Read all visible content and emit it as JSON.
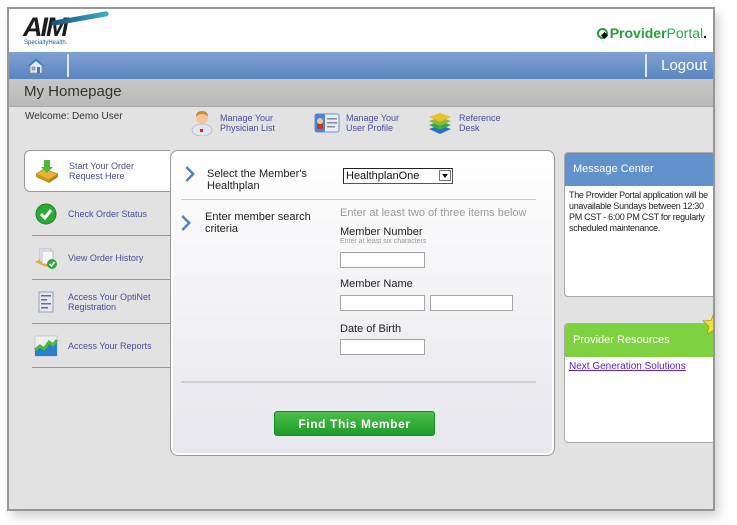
{
  "header": {
    "logo_text": "AIM",
    "logo_subtext": "SpecialtyHealth.",
    "portal_bold": "Provider",
    "portal_light": "Portal",
    "portal_dot": "."
  },
  "navbar": {
    "home_icon": "home-icon",
    "logout_label": "Logout"
  },
  "page": {
    "title": "My Homepage",
    "welcome": "Welcome: Demo User"
  },
  "quick_links": [
    {
      "icon": "physician-icon",
      "label": "Manage Your Physician List"
    },
    {
      "icon": "user-profile-card-icon",
      "label": "Manage Your User Profile"
    },
    {
      "icon": "books-icon",
      "label": "Reference Desk"
    }
  ],
  "sidebar": {
    "items": [
      {
        "icon": "inbox-download-icon",
        "label": "Start Your Order Request Here",
        "active": true
      },
      {
        "icon": "green-check-icon",
        "label": "Check Order Status"
      },
      {
        "icon": "order-history-icon",
        "label": "View Order History"
      },
      {
        "icon": "registration-form-icon",
        "label": "Access Your OptiNet Registration"
      },
      {
        "icon": "reports-chart-icon",
        "label": "Access Your Reports"
      }
    ]
  },
  "form": {
    "step1_label": "Select the Member's Healthplan",
    "healthplan_selected": "HealthplanOne",
    "step2_label": "Enter member search criteria",
    "hint": "Enter at least two of three items below",
    "member_number_label": "Member Number",
    "member_number_sub": "Enter at least six characters",
    "member_number_value": "",
    "member_name_label": "Member Name",
    "member_first_name_value": "",
    "member_last_name_value": "",
    "dob_label": "Date of Birth",
    "dob_value": "",
    "find_button": "Find This Member"
  },
  "message_center": {
    "title": "Message Center",
    "body": "The Provider Portal application will be unavailable Sundays between 12:30 PM CST - 6:00 PM CST for regularly scheduled maintenance.",
    "color": "#6292cc"
  },
  "provider_resources": {
    "title": "Provider Resources",
    "links": [
      {
        "label": "Next Generation Solutions"
      }
    ],
    "color": "#7ed13f"
  },
  "colors": {
    "navbar": "#5a85c0",
    "find_button": "#2aa836",
    "link": "#4a4e96"
  }
}
